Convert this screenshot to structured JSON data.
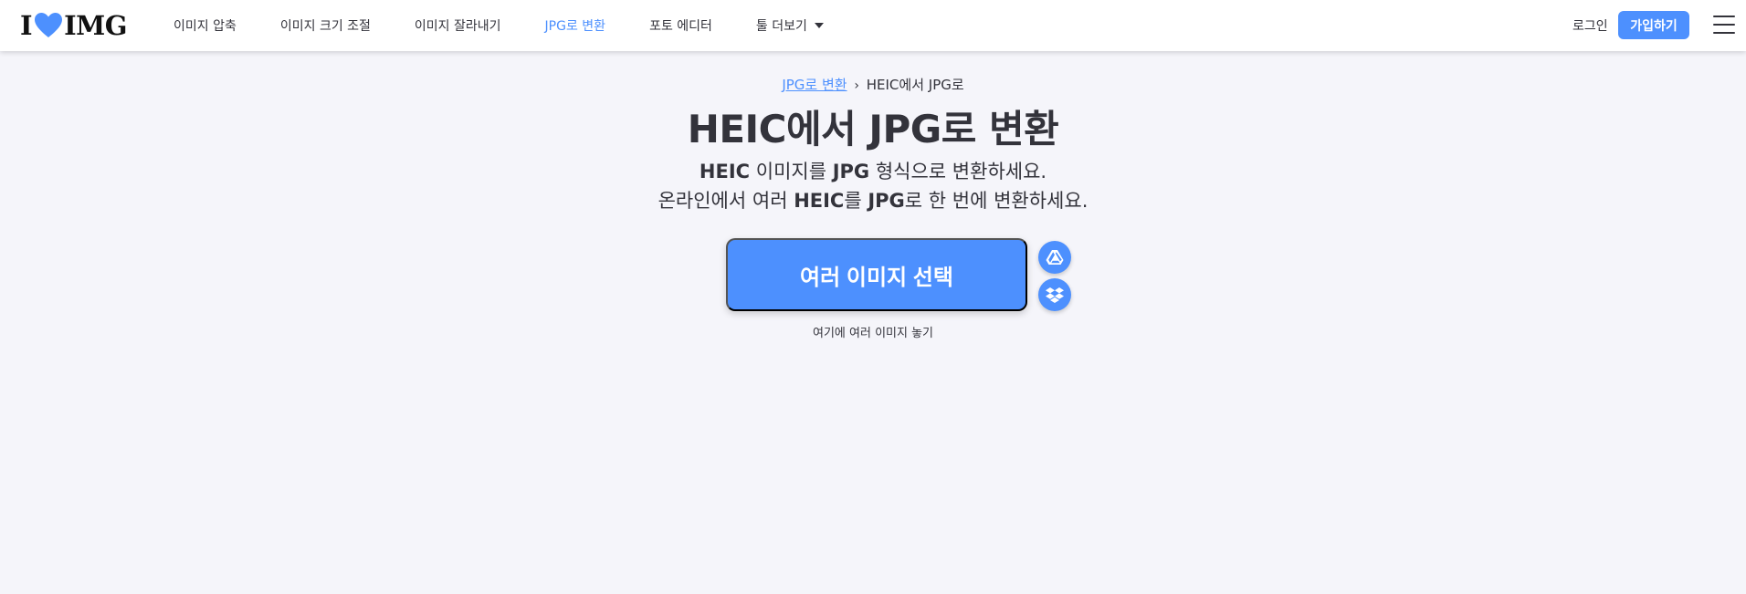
{
  "header": {
    "logo": {
      "left": "I",
      "right": "IMG",
      "heart_color": "#4d90fe"
    },
    "nav": [
      {
        "label": "이미지 압축"
      },
      {
        "label": "이미지 크기 조절"
      },
      {
        "label": "이미지 잘라내기"
      },
      {
        "label": "JPG로 변환",
        "active": true
      },
      {
        "label": "포토 에디터"
      },
      {
        "label": "툴 더보기",
        "dropdown": true
      }
    ],
    "login": "로그인",
    "signup": "가입하기"
  },
  "breadcrumb": {
    "parent": "JPG로 변환",
    "separator": "›",
    "current": "HEIC에서 JPG로"
  },
  "title": "HEIC에서 JPG로 변환",
  "subtitle": {
    "line1": {
      "b1": "HEIC",
      "t1": " 이미지를 ",
      "b2": "JPG",
      "t2": " 형식으로 변환하세요."
    },
    "line2": {
      "t0": "온라인에서 여러 ",
      "b1": "HEIC",
      "t1": "를 ",
      "b2": "JPG",
      "t2": "로 한 번에 변환하세요."
    }
  },
  "upload": {
    "button_label": "여러 이미지 선택",
    "drop_hint": "여기에 여러 이미지 놓기",
    "cloud_icons": [
      "google-drive-icon",
      "dropbox-icon"
    ]
  },
  "colors": {
    "accent": "#4d90fe",
    "background": "#f5f5fa",
    "text": "#33333b"
  }
}
